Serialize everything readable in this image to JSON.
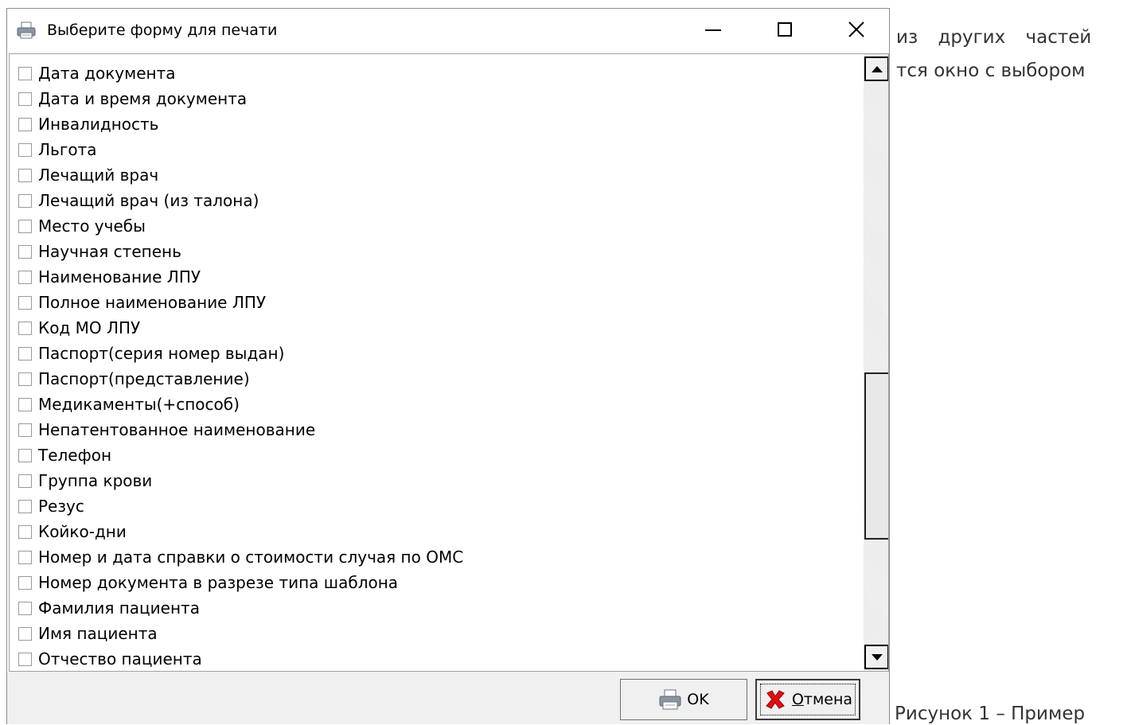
{
  "background_text": {
    "line1": "из других частей",
    "line2": "тся окно с выбором",
    "caption": "Рисунок 1 – Пример"
  },
  "dialog": {
    "title": "Выберите форму для печати",
    "title_icon": "printer-icon",
    "controls": {
      "minimize": "minimize-icon",
      "maximize": "maximize-icon",
      "close": "close-icon"
    }
  },
  "list": {
    "items": [
      {
        "label": "Дата документа",
        "checked": false
      },
      {
        "label": "Дата и время документа",
        "checked": false
      },
      {
        "label": "Инвалидность",
        "checked": false
      },
      {
        "label": "Льгота",
        "checked": false
      },
      {
        "label": "Лечащий врач",
        "checked": false
      },
      {
        "label": "Лечащий врач (из талона)",
        "checked": false
      },
      {
        "label": "Место учебы",
        "checked": false
      },
      {
        "label": "Научная степень",
        "checked": false
      },
      {
        "label": "Наименование ЛПУ",
        "checked": false
      },
      {
        "label": "Полное наименование ЛПУ",
        "checked": false
      },
      {
        "label": "Код МО ЛПУ",
        "checked": false
      },
      {
        "label": "Паспорт(серия номер выдан)",
        "checked": false
      },
      {
        "label": "Паспорт(представление)",
        "checked": false
      },
      {
        "label": "Медикаменты(+способ)",
        "checked": false
      },
      {
        "label": "Непатентованное наименование",
        "checked": false
      },
      {
        "label": "Телефон",
        "checked": false
      },
      {
        "label": "Группа крови",
        "checked": false
      },
      {
        "label": "Резус",
        "checked": false
      },
      {
        "label": "Койко-дни",
        "checked": false
      },
      {
        "label": "Номер и дата справки о стоимости случая по ОМС",
        "checked": false
      },
      {
        "label": "Номер документа в разрезе типа шаблона",
        "checked": false
      },
      {
        "label": "Фамилия пациента",
        "checked": false
      },
      {
        "label": "Имя пациента",
        "checked": false
      },
      {
        "label": "Отчество пациента",
        "checked": false
      }
    ]
  },
  "buttons": {
    "ok": {
      "label": "OK",
      "icon": "printer-icon"
    },
    "cancel": {
      "label": "Отмена",
      "icon": "red-x-icon"
    }
  },
  "colors": {
    "cancel_icon": "#e01010",
    "window_border": "#8e8e8e",
    "footer_bg": "#f0f0f0"
  }
}
